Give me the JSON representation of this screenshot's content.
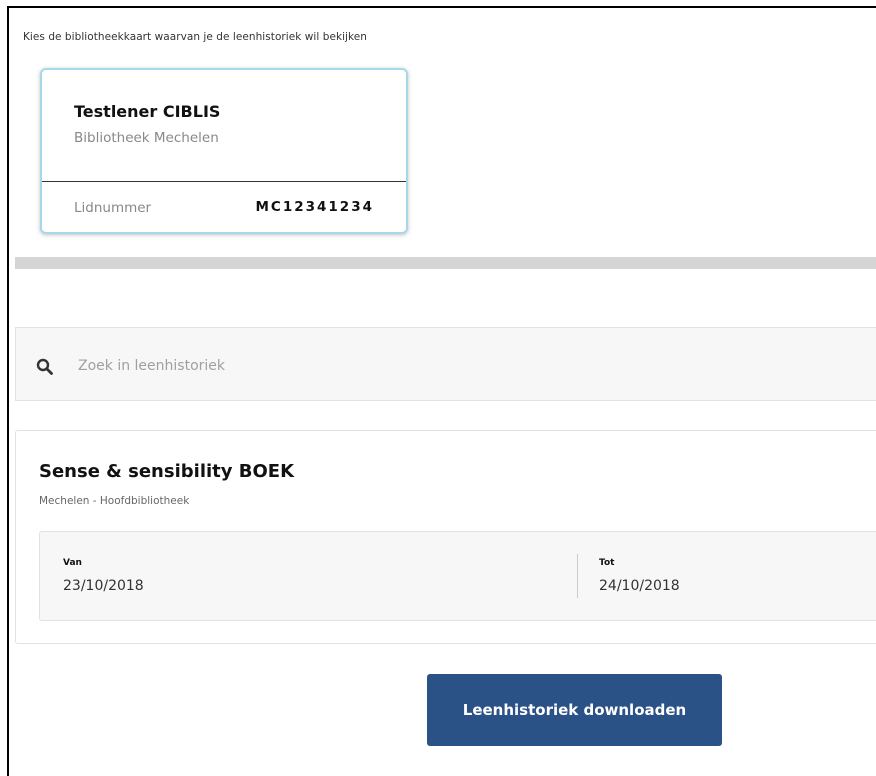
{
  "instruction": "Kies de bibliotheekkaart waarvan je de leenhistoriek wil bekijken",
  "library_card": {
    "name": "Testlener CIBLIS",
    "library": "Bibliotheek Mechelen",
    "member_label": "Lidnummer",
    "member_number": "MC12341234",
    "border_color": "#a6d8ea"
  },
  "search": {
    "placeholder": "Zoek in leenhistoriek",
    "value": "",
    "icon": "search-icon"
  },
  "loan_history": {
    "items": [
      {
        "title": "Sense & sensibility BOEK",
        "location": "Mechelen - Hoofdbibliotheek",
        "from_label": "Van",
        "from_date": "23/10/2018",
        "to_label": "Tot",
        "to_date": "24/10/2018"
      }
    ]
  },
  "download_button": {
    "label": "Leenhistoriek downloaden",
    "color": "#2b5286"
  }
}
